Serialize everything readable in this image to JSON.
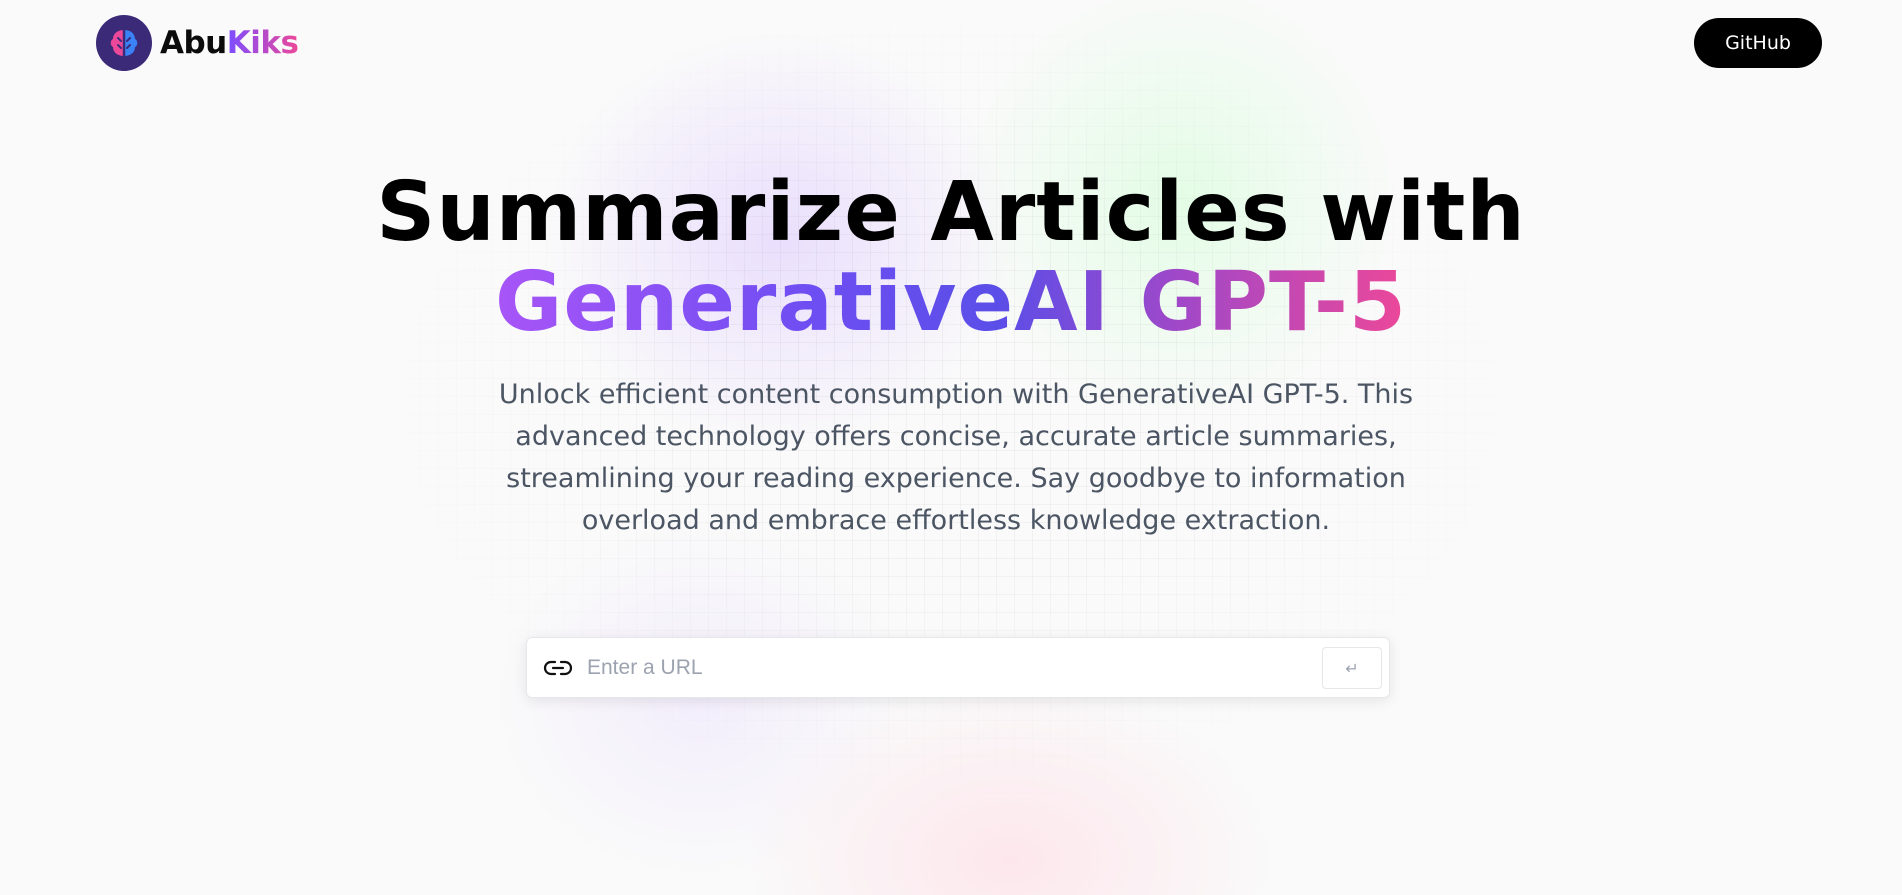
{
  "nav": {
    "logo_icon": "brain-icon",
    "brand_primary": "Abu",
    "brand_accent": "Kiks",
    "github_label": "GitHub"
  },
  "hero": {
    "title_line1": "Summarize Articles with",
    "title_gradient": "GenerativeAI GPT-5",
    "description": "Unlock efficient content consumption with GenerativeAI GPT-5. This advanced technology offers concise, accurate article summaries, streamlining your reading experience. Say goodbye to information overload and embrace effortless knowledge extraction."
  },
  "url_form": {
    "icon": "link-icon",
    "value": "",
    "placeholder": "Enter a URL",
    "submit_label": "↵"
  },
  "colors": {
    "brand_gradient_start": "#7c4dff",
    "brand_gradient_end": "#ec4899",
    "hero_gradient": [
      "#a855f7",
      "#5b4ee8",
      "#ec4899"
    ],
    "github_button_bg": "#000000",
    "description_text": "#4b5563"
  }
}
